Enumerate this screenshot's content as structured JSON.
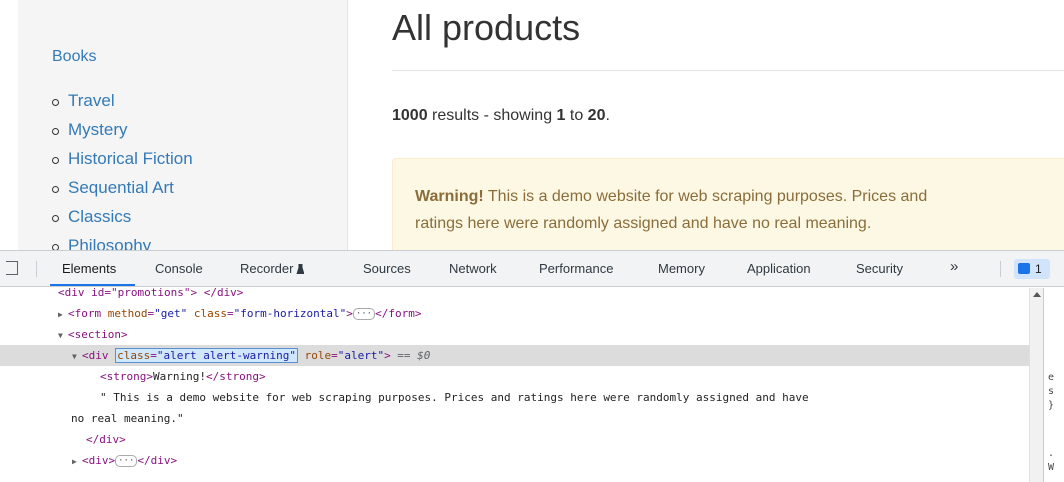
{
  "page": {
    "sidebar": {
      "books": "Books",
      "categories": [
        "Travel",
        "Mystery",
        "Historical Fiction",
        "Sequential Art",
        "Classics",
        "Philosophy"
      ]
    },
    "heading": "All products",
    "results": {
      "count": "1000",
      "mid": " results - showing ",
      "from": "1",
      "to_word": " to ",
      "to": "20",
      "end": "."
    },
    "alert": {
      "strong": "Warning!",
      "line1": " This is a demo website for web scraping purposes. Prices and",
      "line2": "ratings here were randomly assigned and have no real meaning."
    }
  },
  "devtools": {
    "tabs": [
      "Elements",
      "Console",
      "Recorder",
      "Sources",
      "Network",
      "Performance",
      "Memory",
      "Application",
      "Security"
    ],
    "more": "»",
    "badge_count": "1",
    "dom": {
      "l1": "<div id=\"promotions\"> </div>",
      "l2_a": "<form ",
      "l2_attr1": "method",
      "l2_val1": "\"get\"",
      "l2_attr2": "class",
      "l2_val2": "\"form-horizontal\"",
      "l2_b": ">",
      "l2_c": "</form>",
      "l3": "<section>",
      "l4_open": "<div ",
      "l4_attr1": "class",
      "l4_eq1": "=",
      "l4_val1": "\"alert alert-warning\"",
      "l4_attr2": "role",
      "l4_val2": "\"alert\"",
      "l4_close": ">",
      "l4_ref": " == $0",
      "l5_open": "<strong>",
      "l5_text": "Warning!",
      "l5_close": "</strong>",
      "l6": "\" This is a demo website for web scraping purposes. Prices and ratings here were randomly assigned and have",
      "l7": "no real meaning.\"",
      "l8": "</div>",
      "l9_a": "<div>",
      "l9_b": "</div>"
    },
    "side_panel": [
      "e",
      "s",
      "}",
      ".",
      "W"
    ]
  }
}
